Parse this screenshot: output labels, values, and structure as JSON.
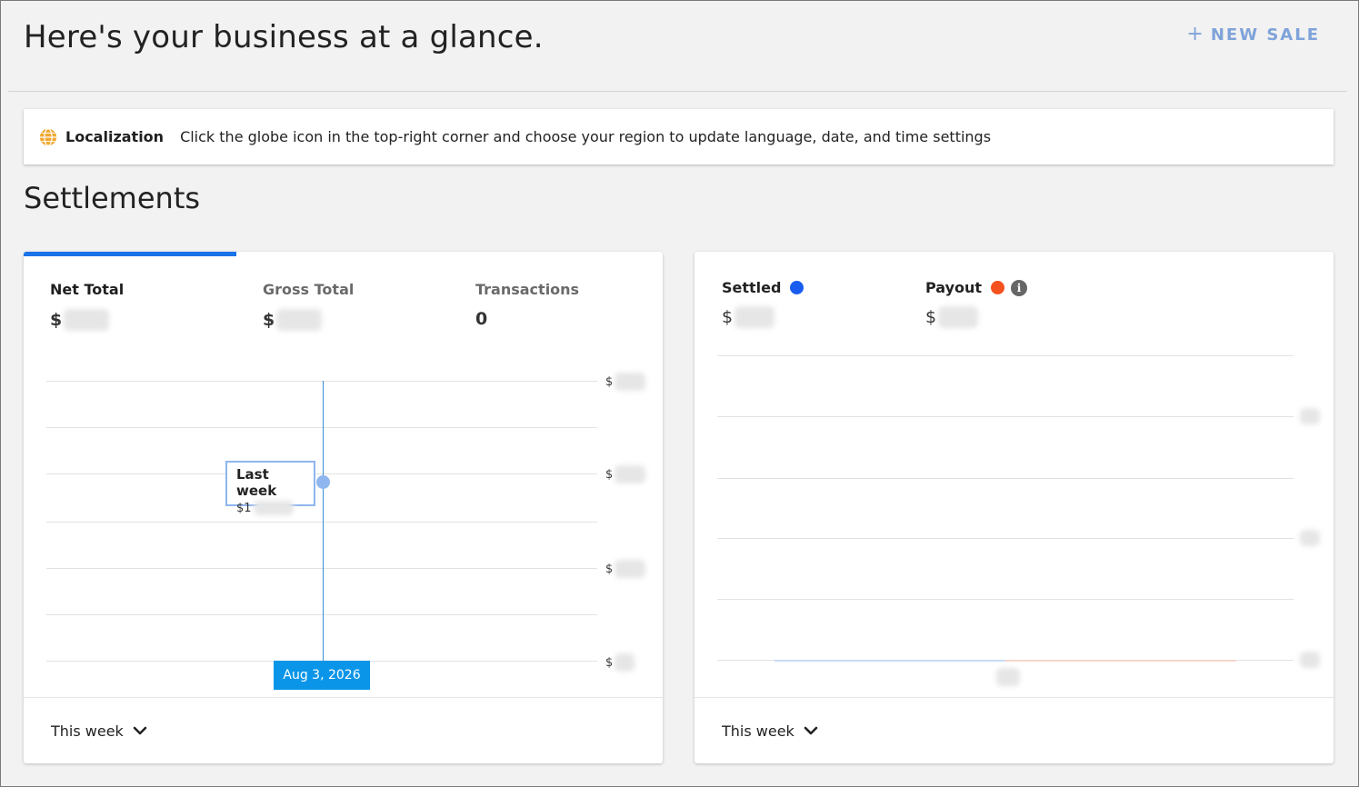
{
  "header": {
    "title": "Here's your business at a glance.",
    "new_sale_icon": "+",
    "new_sale_label": "NEW SALE"
  },
  "banner": {
    "icon": "globe-icon",
    "title": "Localization",
    "text": "Click the globe icon in the top-right corner and choose your region to update language, date, and time settings"
  },
  "settlements": {
    "title": "Settlements",
    "left_card": {
      "metrics": [
        {
          "label": "Net Total",
          "value": "$",
          "active": true
        },
        {
          "label": "Gross Total",
          "value": "$",
          "active": false
        },
        {
          "label": "Transactions",
          "value": "0",
          "active": false
        }
      ],
      "y_tick_prefix": "$",
      "tooltip": {
        "title": "Last week",
        "value": "$1"
      },
      "date_badge": "Aug 3, 2026",
      "period_label": "This week"
    },
    "right_card": {
      "legend": [
        {
          "label": "Settled",
          "value": "$",
          "color": "#1a5cf0"
        },
        {
          "label": "Payout",
          "value": "$",
          "color": "#f4511e"
        }
      ],
      "period_label": "This week"
    }
  },
  "colors": {
    "accent": "#1a73e8",
    "new_sale": "#7fa3d9",
    "date_badge": "#0a95e8",
    "tooltip_border": "#8fb6ee"
  }
}
